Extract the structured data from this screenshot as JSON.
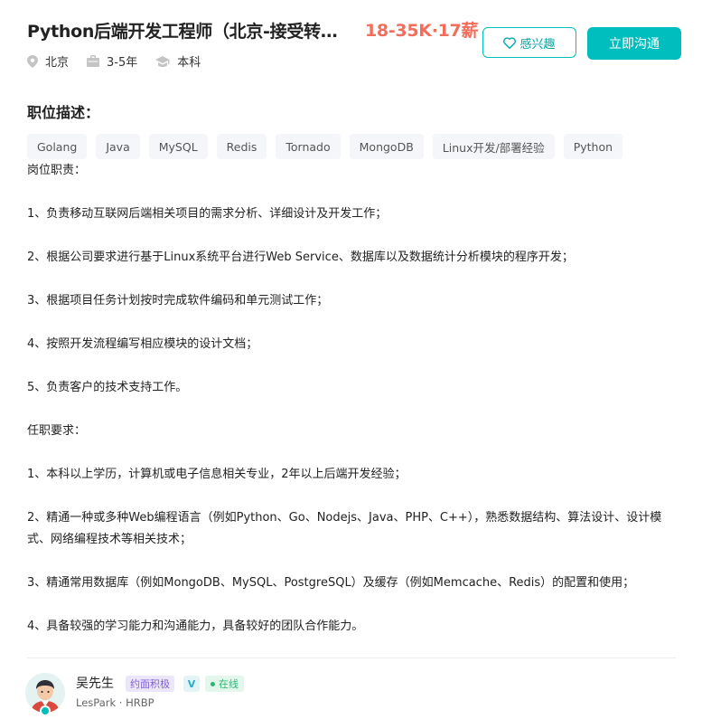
{
  "job": {
    "title": "Python后端开发工程师（北京-接受转…",
    "salary": "18-35K·17薪",
    "location": "北京",
    "experience": "3-5年",
    "degree": "本科"
  },
  "actions": {
    "interest_label": "感兴趣",
    "chat_label": "立即沟通"
  },
  "description": {
    "section_title": "职位描述：",
    "tags": [
      "Golang",
      "Java",
      "MySQL",
      "Redis",
      "Tornado",
      "MongoDB",
      "Linux开发/部署经验",
      "Python"
    ],
    "lines": [
      "岗位职责：",
      "1、负责移动互联网后端相关项目的需求分析、详细设计及开发工作；",
      "2、根据公司要求进行基于Linux系统平台进行Web Service、数据库以及数据统计分析模块的程序开发；",
      "3、根据项目任务计划按时完成软件编码和单元测试工作；",
      "4、按照开发流程编写相应模块的设计文档；",
      "5、负责客户的技术支持工作。",
      "任职要求：",
      "1、本科以上学历，计算机或电子信息相关专业，2年以上后端开发经验；",
      "2、精通一种或多种Web编程语言（例如Python、Go、Nodejs、Java、PHP、C++），熟悉数据结构、算法设计、设计模式、网络编程技术等相关技术；",
      "3、精通常用数据库（例如MongoDB、MySQL、PostgreSQL）及缓存（例如Memcache、Redis）的配置和使用；",
      "4、具备较强的学习能力和沟通能力，具备较好的团队合作能力。"
    ]
  },
  "recruiter": {
    "name": "吴先生",
    "badge_active": "约面积极",
    "badge_verified": "V",
    "status": "在线",
    "company": "LesPark · HRBP"
  },
  "colors": {
    "accent": "#00bebd",
    "salary": "#f26d5b"
  }
}
